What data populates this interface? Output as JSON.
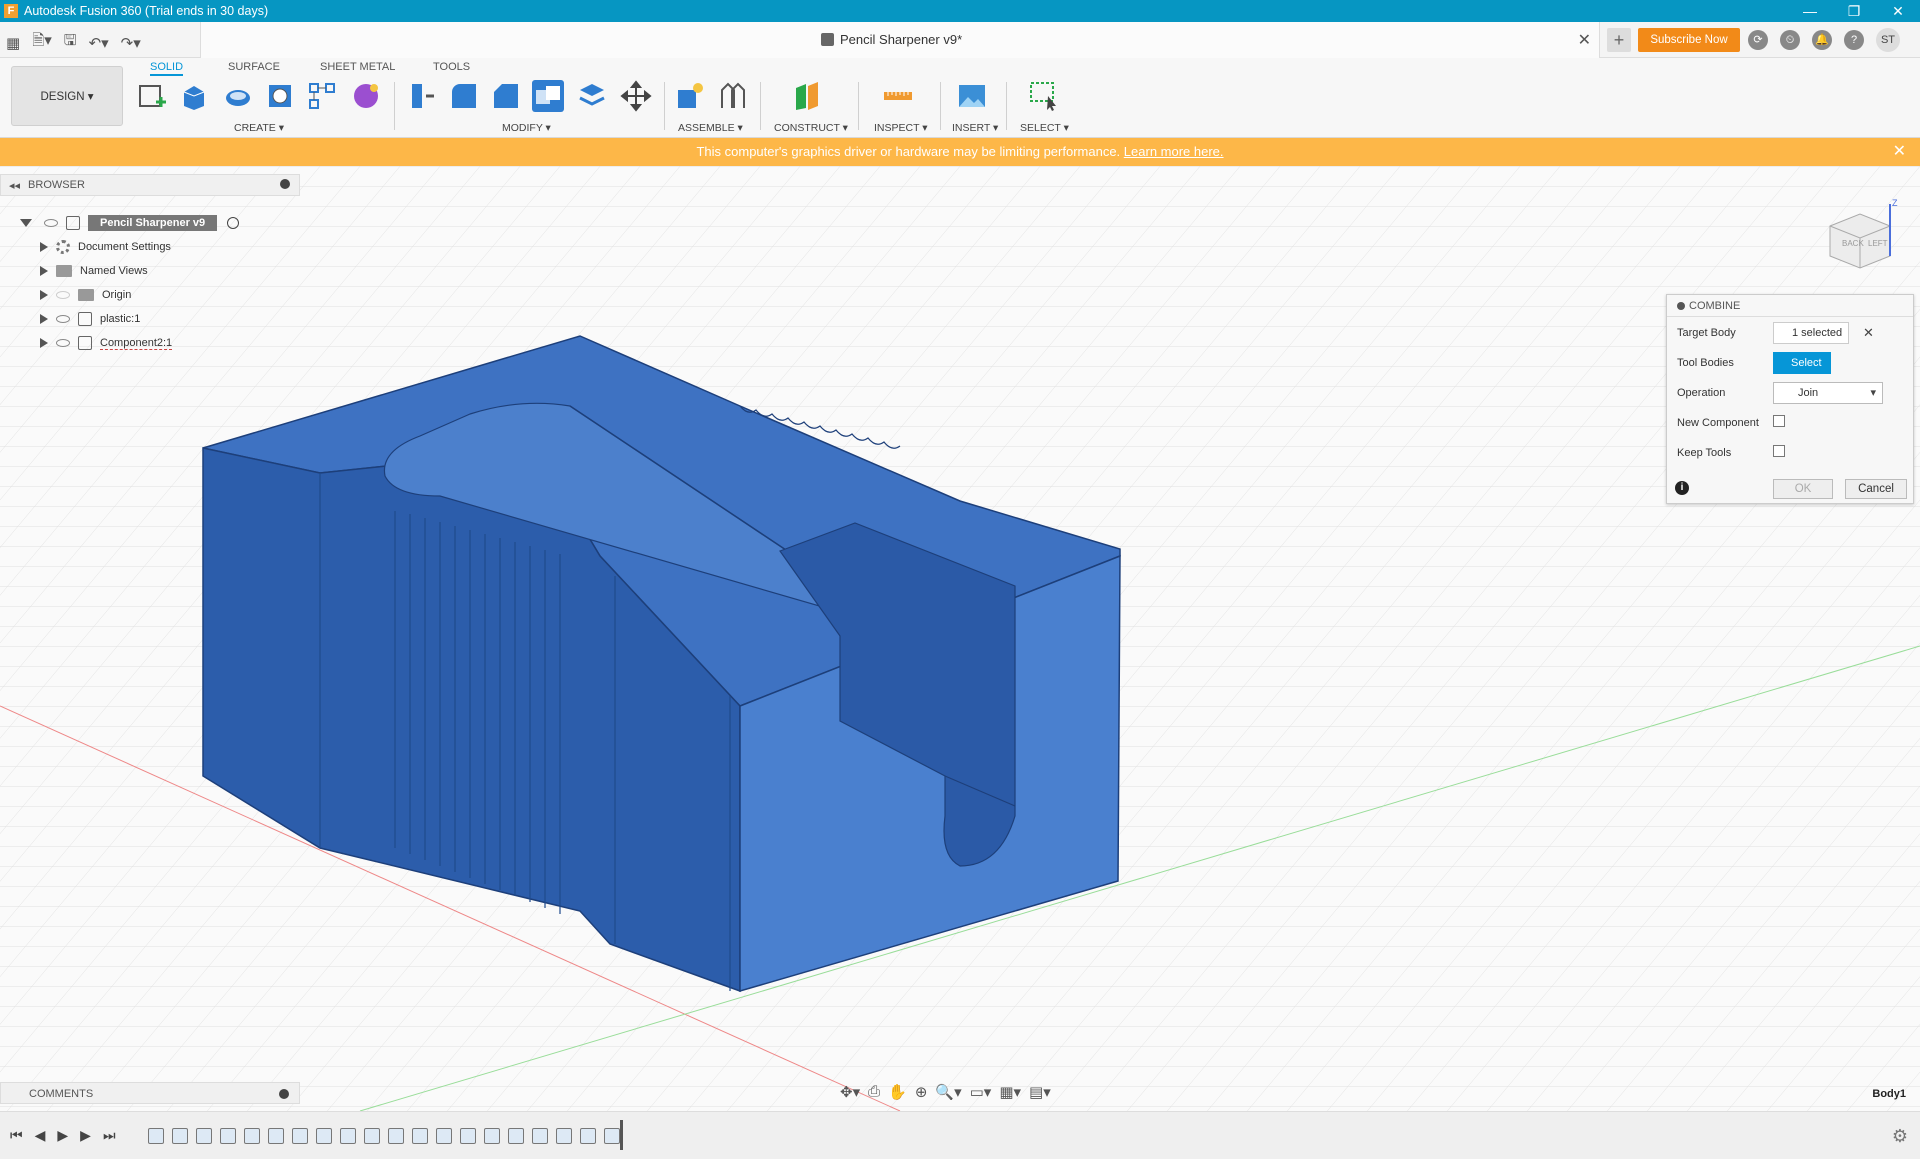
{
  "titlebar": {
    "app_logo": "F",
    "title": "Autodesk Fusion 360 (Trial ends in 30 days)",
    "minimize": "—",
    "restore": "❐",
    "close": "✕"
  },
  "quick_access": {
    "grid_icon": "▦",
    "file_icon": "🗎▾",
    "save_icon": "🖫",
    "undo_icon": "↶▾",
    "redo_icon": "↷▾"
  },
  "document": {
    "title": "Pencil Sharpener v9*",
    "close": "✕",
    "new_tab": "+",
    "subscribe": "Subscribe Now",
    "avatar": "ST",
    "icons": [
      "⟳",
      "⏲",
      "🔔",
      "?"
    ]
  },
  "toolbar": {
    "workspace": "DESIGN ▾",
    "tabs": [
      "SOLID",
      "SURFACE",
      "SHEET METAL",
      "TOOLS"
    ],
    "active_tab": "SOLID",
    "groups": [
      "CREATE ▾",
      "MODIFY ▾",
      "ASSEMBLE ▾",
      "CONSTRUCT ▾",
      "INSPECT ▾",
      "INSERT ▾",
      "SELECT ▾"
    ],
    "colors": {
      "accent": "#0696d7",
      "tool_blue": "#2f7dd0"
    }
  },
  "warning": {
    "text": "This computer's graphics driver or hardware may be limiting performance.",
    "link": "Learn more here.",
    "close": "✕"
  },
  "browser": {
    "title": "BROWSER",
    "collapse": "◂◂",
    "root": "Pencil Sharpener v9",
    "items": [
      "Document Settings",
      "Named Views",
      "Origin",
      "plastic:1",
      "Component2:1"
    ]
  },
  "combine": {
    "title": "COMBINE",
    "target_body_label": "Target Body",
    "target_body_value": "1 selected",
    "clear": "✕",
    "tool_bodies_label": "Tool Bodies",
    "tool_bodies_value": "Select",
    "operation_label": "Operation",
    "operation_value": "Join",
    "new_component_label": "New Component",
    "keep_tools_label": "Keep Tools",
    "info": "i",
    "ok": "OK",
    "cancel": "Cancel"
  },
  "comments": {
    "title": "COMMENTS"
  },
  "navbar": {
    "icons": [
      "✥▾",
      "⎙",
      "✋",
      "⊕",
      "🔍▾",
      "▭▾",
      "▦▾",
      "▤▾"
    ]
  },
  "body_label": "Body1",
  "timeline": {
    "controls": [
      "⏮",
      "◀",
      "▶",
      "▶",
      "⏭"
    ],
    "settings": "⚙"
  },
  "viewcube": {
    "left": "LEFT",
    "back": "BACK",
    "z_axis": "Z"
  }
}
